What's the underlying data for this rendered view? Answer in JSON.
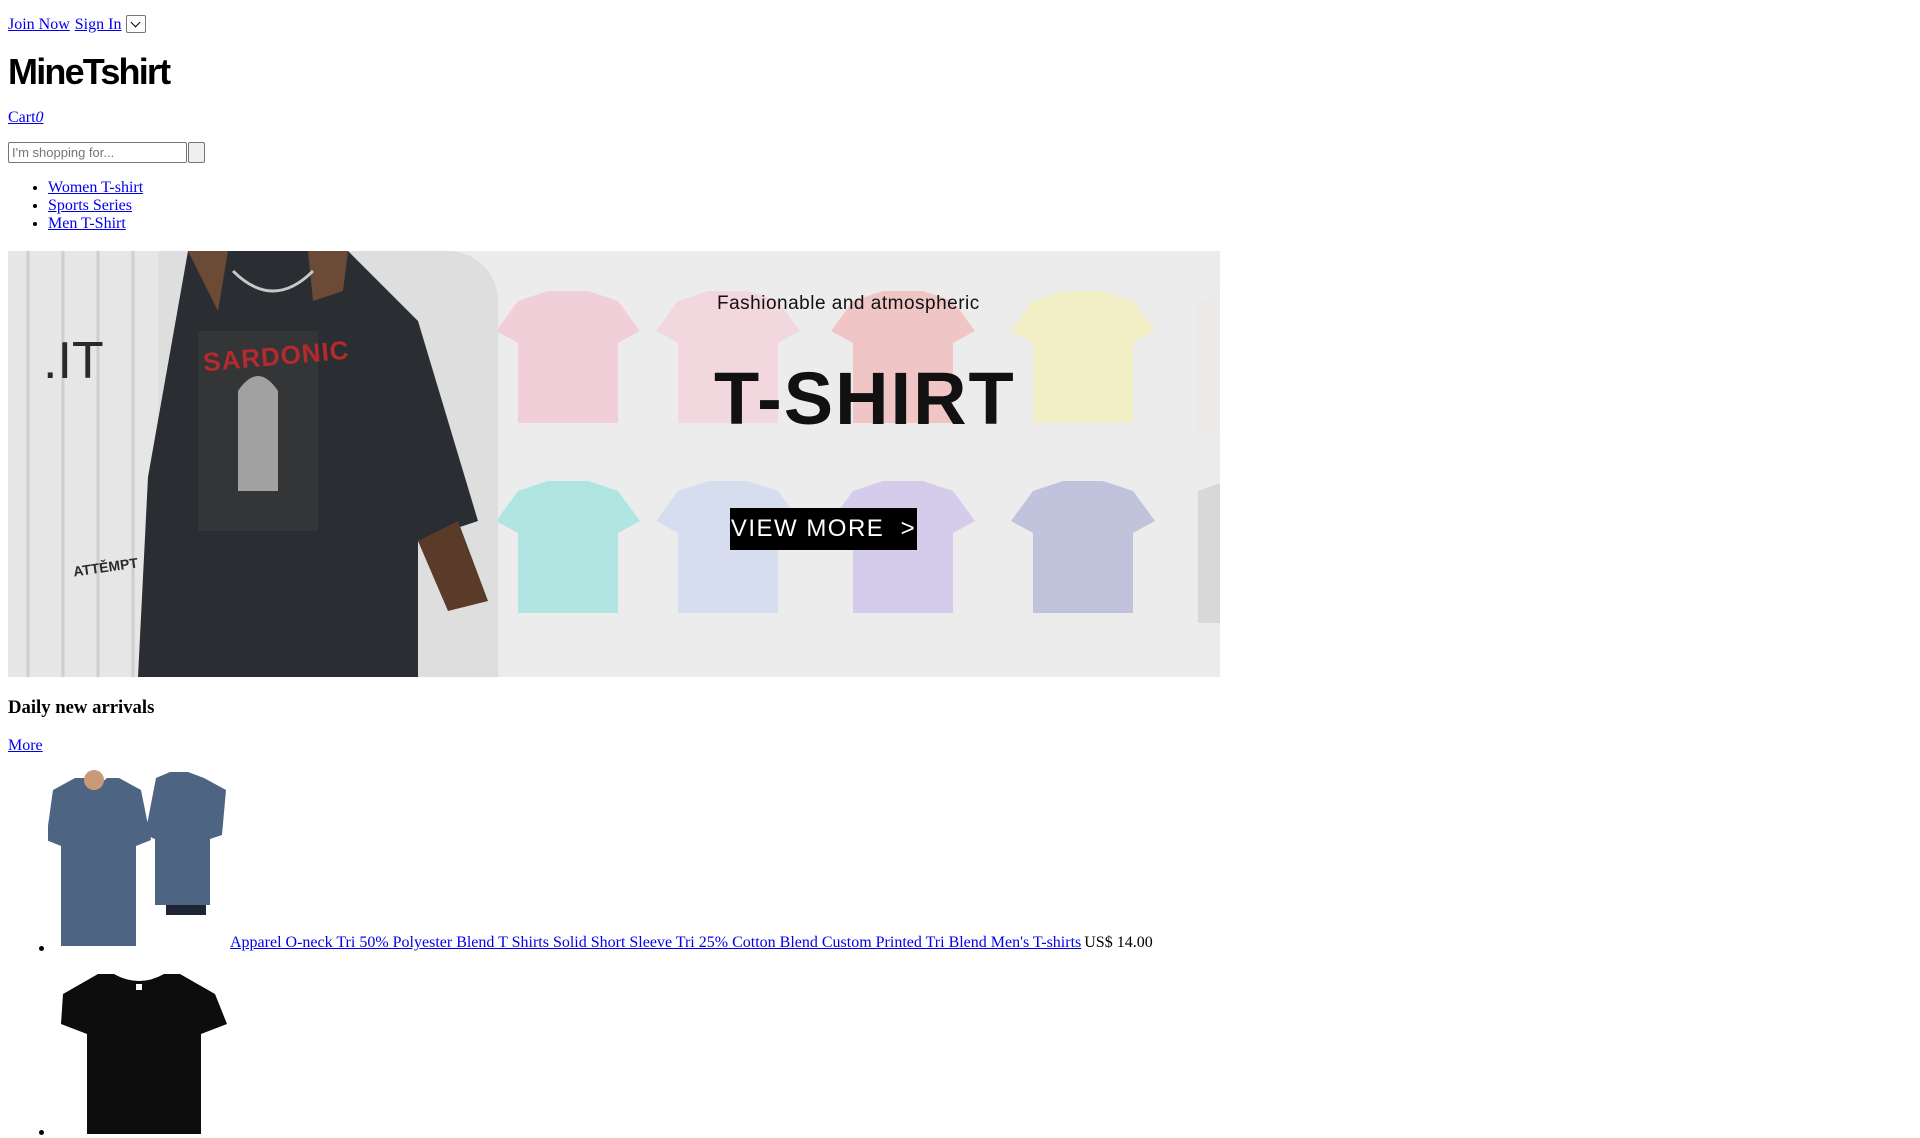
{
  "header": {
    "join_label": "Join Now",
    "signin_label": "Sign In",
    "logo": "MineTshirt",
    "cart_label": "Cart",
    "cart_count": "0"
  },
  "search": {
    "placeholder": "I'm shopping for...",
    "value": ""
  },
  "nav": {
    "items": [
      {
        "label": "Women T-shirt"
      },
      {
        "label": "Sports Series"
      },
      {
        "label": "Men T-Shirt"
      }
    ]
  },
  "banner": {
    "tagline": "Fashionable and atmospheric",
    "headline": "T-SHIRT",
    "cta": "VIEW MORE  >",
    "wall_text": ".IT",
    "brand_text": "ATTĚMPT",
    "shirt_print": "SARDONIC"
  },
  "section": {
    "title": "Daily new arrivals",
    "more_label": "More"
  },
  "products": [
    {
      "title": "Apparel O-neck Tri 50% Polyester Blend T Shirts Solid Short Sleeve Tri 25% Cotton Blend Custom Printed Tri Blend Men's T-shirts",
      "price": "US$ 14.00"
    },
    {
      "title": "",
      "price": ""
    }
  ],
  "colors": {
    "link": "#0000ee",
    "banner_bg": "#ececec",
    "cta_bg": "#000000",
    "headline": "#111111"
  }
}
